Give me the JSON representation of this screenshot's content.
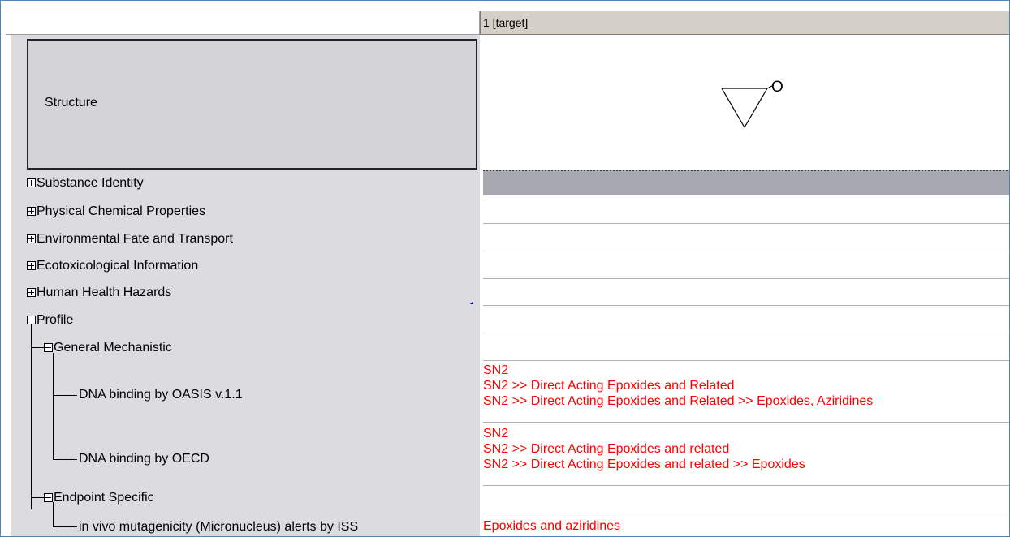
{
  "header": {
    "column_label": "1 [target]"
  },
  "structure": {
    "label": "Structure",
    "molecule_atom": "O"
  },
  "tree": {
    "substance_identity": "Substance Identity",
    "physical_chemical": "Physical Chemical Properties",
    "environmental_fate": "Environmental Fate and Transport",
    "ecotox": "Ecotoxicological Information",
    "human_health": "Human Health Hazards",
    "profile": "Profile",
    "general_mechanistic": "General Mechanistic",
    "dna_oasis": "DNA binding by OASIS v.1.1",
    "dna_oecd": "DNA binding by OECD",
    "endpoint_specific": "Endpoint Specific",
    "in_vivo": "in vivo mutagenicity (Micronucleus) alerts by ISS"
  },
  "values": {
    "dna_oasis": [
      "SN2",
      "SN2 >> Direct Acting Epoxides and Related",
      "SN2 >> Direct Acting Epoxides and Related >> Epoxides, Aziridines"
    ],
    "dna_oecd": [
      "SN2",
      "SN2 >> Direct Acting Epoxides and related",
      "SN2 >> Direct Acting Epoxides and related >> Epoxides"
    ],
    "in_vivo": [
      "Epoxides and aziridines"
    ]
  },
  "colors": {
    "alert_text": "#ff0000",
    "panel_gray": "#dcdce0",
    "window_border": "#4a86b8"
  }
}
